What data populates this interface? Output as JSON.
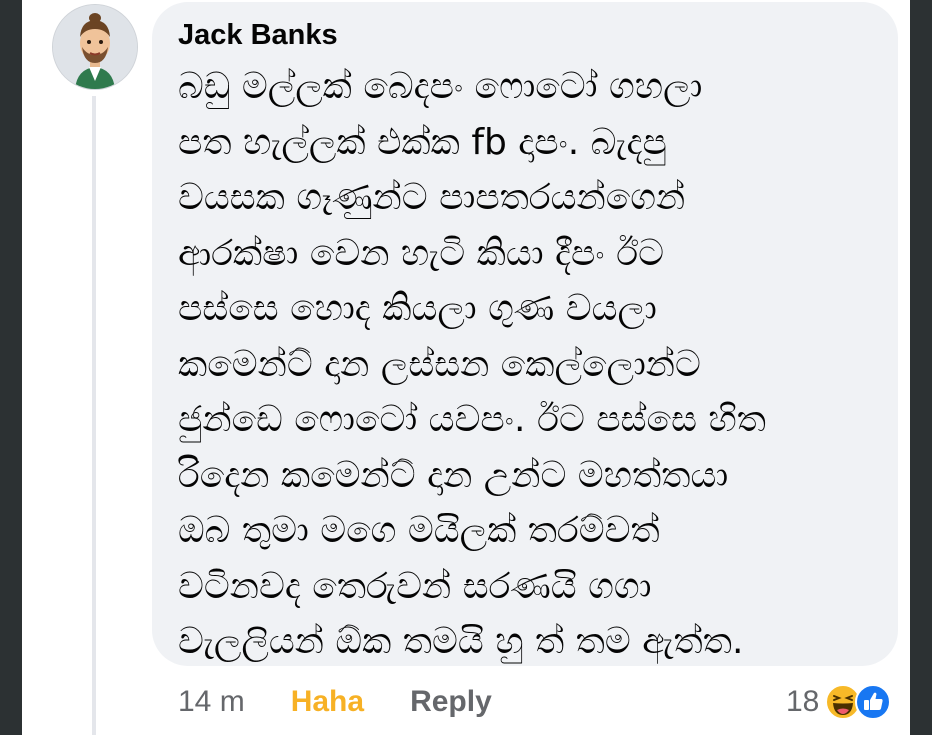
{
  "comment": {
    "author": "Jack Banks",
    "text": "බඩු මල්ලක් බෙදපං ෆොටෝ ගහලා\nපත හැල්ලක් එක්ක fb දාපං. බැදපු\nවයසක ගෑණුන්ට පාපතරයන්ගෙන්\nආරක්ෂා වෙන හැටි කියා දීපං ඊට\nපස්සෙ හොද කියලා ගුණ වයලා\nකමෙන්ට් දාන ලස්සන කෙල්ලොන්ට\nජුන්ඩෙ ෆොටෝ යවපං. ඊට පස්සෙ හිත\nරිදෙන කමෙන්ට් දාන උන්ට මහත්තයා\nඔබ තුමා මගෙ මයිලක් තරම්වත්\nවටිනවද තෙරුවන් සරණයි ගගා\nවැලලියන් ඕක තමයි හු ත් තම ඇත්ත.",
    "timestamp": "14 m",
    "haha_label": "Haha",
    "reply_label": "Reply",
    "reaction_count": "18",
    "reaction_icons": [
      "haha-emoji-icon",
      "like-icon"
    ],
    "colors": {
      "haha": "#f7b125",
      "like": "#1877f2",
      "bubble": "#f0f2f5",
      "meta": "#65676b"
    }
  }
}
